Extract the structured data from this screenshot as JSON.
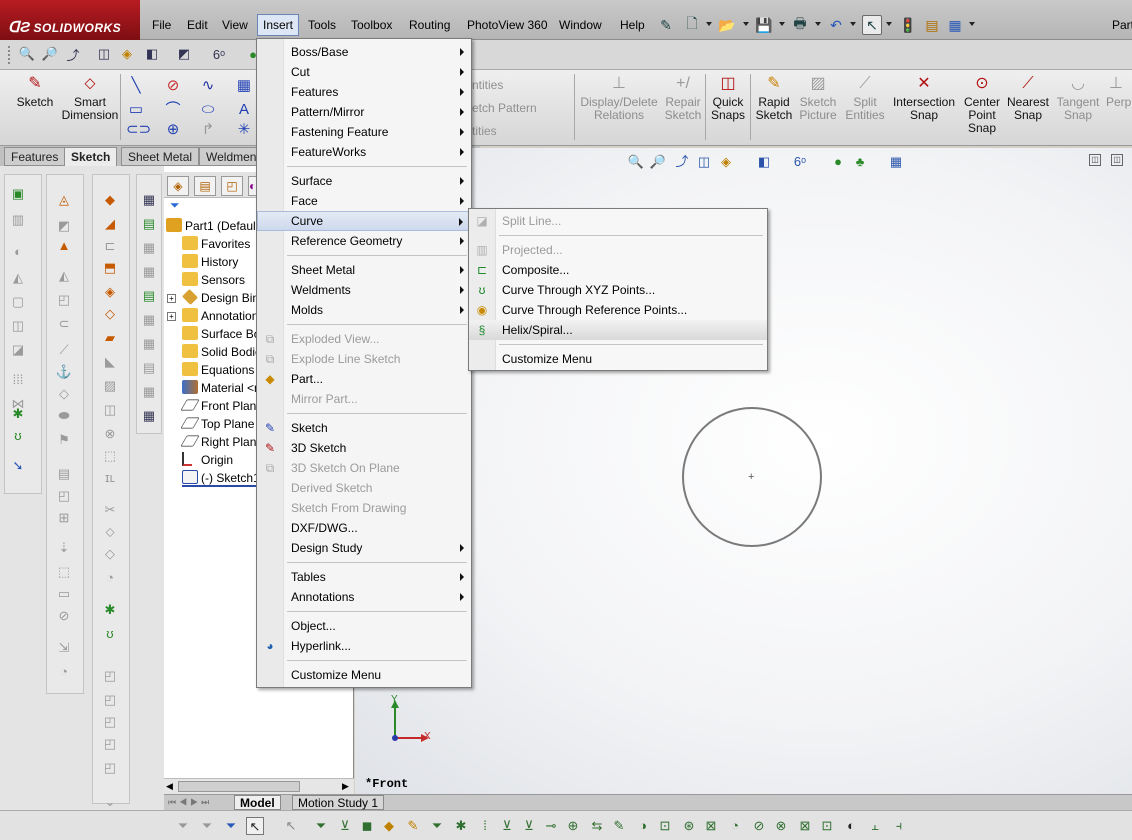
{
  "app": {
    "logo": "SOLIDWORKS",
    "document_title": "Part"
  },
  "menubar": {
    "items": [
      "File",
      "Edit",
      "View",
      "Insert",
      "Tools",
      "Toolbox",
      "Routing",
      "PhotoView 360",
      "Window",
      "Help"
    ],
    "active": "Insert"
  },
  "commandmanager": {
    "sketch": "Sketch",
    "smart_dimension_line1": "Smart",
    "smart_dimension_line2": "Dimension",
    "entities_faded": [
      "ntities",
      "etch Pattern",
      "tities"
    ],
    "display_delete_relations_line1": "Display/Delete",
    "display_delete_relations_line2": "Relations",
    "repair_sketch_line1": "Repair",
    "repair_sketch_line2": "Sketch",
    "quick_snaps_line1": "Quick",
    "quick_snaps_line2": "Snaps",
    "rapid_sketch_line1": "Rapid",
    "rapid_sketch_line2": "Sketch",
    "sketch_picture_line1": "Sketch",
    "sketch_picture_line2": "Picture",
    "split_entities_line1": "Split",
    "split_entities_line2": "Entities",
    "intersection_snap_line1": "Intersection",
    "intersection_snap_line2": "Snap",
    "center_point_snap_line1": "Center",
    "center_point_snap_line2": "Point",
    "center_point_snap_line3": "Snap",
    "nearest_snap_line1": "Nearest",
    "nearest_snap_line2": "Snap",
    "tangent_snap_line1": "Tangent",
    "tangent_snap_line2": "Snap",
    "perp_partial": "Perp"
  },
  "tabs": [
    "Features",
    "Sketch",
    "Sheet Metal",
    "Weldmen"
  ],
  "active_tab": "Sketch",
  "feature_tree": {
    "root": "Part1  (Default",
    "items": [
      "Favorites",
      "History",
      "Sensors",
      "Design Bind",
      "Annotation",
      "Surface Bo",
      "Solid Bodies",
      "Equations",
      "Material <n",
      "Front Plane",
      "Top Plane",
      "Right Plane",
      "Origin",
      "(-) Sketch1"
    ]
  },
  "insert_menu": {
    "items": [
      {
        "label": "Boss/Base",
        "submenu": true,
        "enabled": true
      },
      {
        "label": "Cut",
        "submenu": true,
        "enabled": true
      },
      {
        "label": "Features",
        "submenu": true,
        "enabled": true
      },
      {
        "label": "Pattern/Mirror",
        "submenu": true,
        "enabled": true
      },
      {
        "label": "Fastening Feature",
        "submenu": true,
        "enabled": true
      },
      {
        "label": "FeatureWorks",
        "submenu": true,
        "enabled": true
      },
      {
        "label": "Surface",
        "submenu": true,
        "enabled": true
      },
      {
        "label": "Face",
        "submenu": true,
        "enabled": true
      },
      {
        "label": "Curve",
        "submenu": true,
        "enabled": true,
        "highlighted": true
      },
      {
        "label": "Reference Geometry",
        "submenu": true,
        "enabled": true
      },
      {
        "label": "Sheet Metal",
        "submenu": true,
        "enabled": true
      },
      {
        "label": "Weldments",
        "submenu": true,
        "enabled": true
      },
      {
        "label": "Molds",
        "submenu": true,
        "enabled": true
      },
      {
        "label": "Exploded View...",
        "submenu": false,
        "enabled": false
      },
      {
        "label": "Explode Line Sketch",
        "submenu": false,
        "enabled": false
      },
      {
        "label": "Part...",
        "submenu": false,
        "enabled": true
      },
      {
        "label": "Mirror Part...",
        "submenu": false,
        "enabled": false
      },
      {
        "label": "Sketch",
        "submenu": false,
        "enabled": true
      },
      {
        "label": "3D Sketch",
        "submenu": false,
        "enabled": true
      },
      {
        "label": "3D Sketch On Plane",
        "submenu": false,
        "enabled": false
      },
      {
        "label": "Derived Sketch",
        "submenu": false,
        "enabled": false
      },
      {
        "label": "Sketch From Drawing",
        "submenu": false,
        "enabled": false
      },
      {
        "label": "DXF/DWG...",
        "submenu": false,
        "enabled": true
      },
      {
        "label": "Design Study",
        "submenu": true,
        "enabled": true
      },
      {
        "label": "Tables",
        "submenu": true,
        "enabled": true
      },
      {
        "label": "Annotations",
        "submenu": true,
        "enabled": true
      },
      {
        "label": "Object...",
        "submenu": false,
        "enabled": true
      },
      {
        "label": "Hyperlink...",
        "submenu": false,
        "enabled": true
      },
      {
        "label": "Customize Menu",
        "submenu": false,
        "enabled": true
      }
    ]
  },
  "curve_menu": {
    "items": [
      {
        "label": "Split Line...",
        "enabled": false
      },
      {
        "label": "Projected...",
        "enabled": false
      },
      {
        "label": "Composite...",
        "enabled": true
      },
      {
        "label": "Curve Through XYZ Points...",
        "enabled": true
      },
      {
        "label": "Curve Through Reference Points...",
        "enabled": true
      },
      {
        "label": "Helix/Spiral...",
        "enabled": true,
        "highlighted": true
      },
      {
        "label": "Customize Menu",
        "enabled": true
      }
    ]
  },
  "graphics": {
    "view_name": "*Front",
    "axis_x": "X",
    "axis_y": "Y"
  },
  "bottom_tabs": [
    "Model",
    "Motion Study 1"
  ],
  "active_bottom_tab": "Model"
}
